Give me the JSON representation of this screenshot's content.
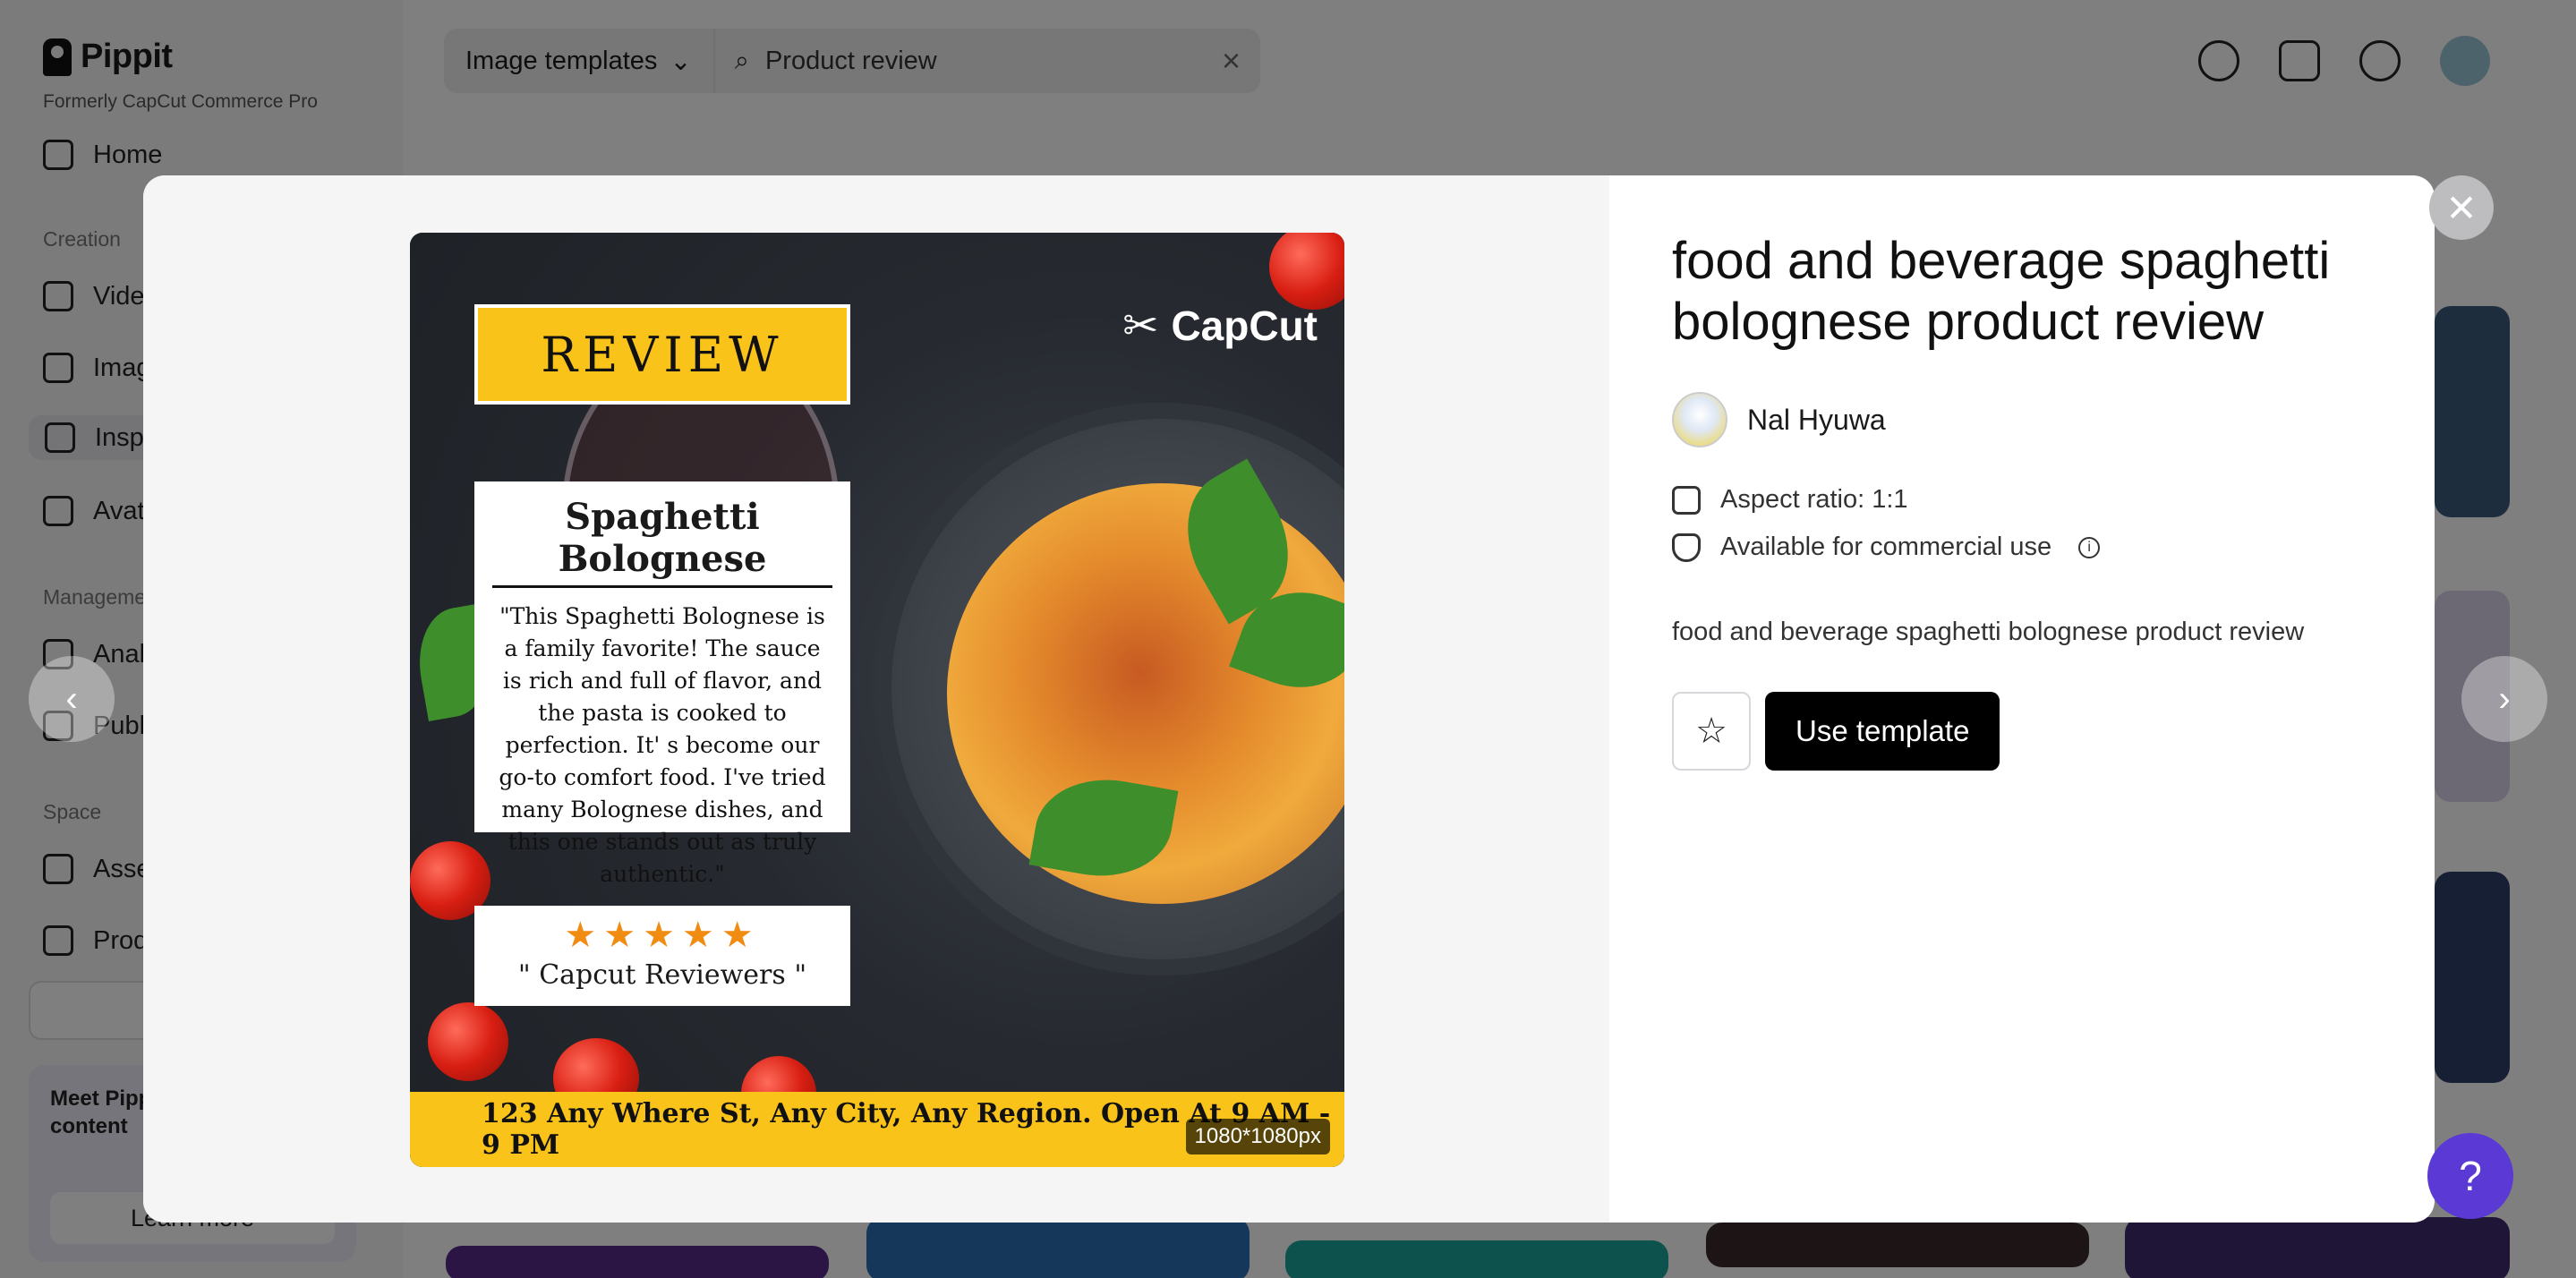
{
  "app": {
    "brand": "Pippit",
    "brand_sub": "Formerly CapCut Commerce Pro",
    "sidebar": {
      "home": "Home",
      "sections": [
        "Creation",
        "Manageme",
        "Space"
      ],
      "items": [
        "Vide",
        "Imag",
        "Insp",
        "Avat",
        "Anal",
        "Publ",
        "Asse",
        "Prod"
      ]
    },
    "promo": {
      "text": "Meet Pipp creative a content",
      "button": "Learn more"
    },
    "search": {
      "category": "Image templates",
      "query": "Product review"
    }
  },
  "modal": {
    "title": "food and beverage spaghetti bolognese product review",
    "author": "Nal Hyuwa",
    "aspect_ratio": "Aspect ratio: 1:1",
    "commercial": "Available for commercial use",
    "description": "food and beverage spaghetti bolognese product review",
    "use_button": "Use template",
    "preview": {
      "banner": "REVIEW",
      "brand": "CapCut",
      "card_title": "Spaghetti Bolognese",
      "card_text": "\"This Spaghetti Bolognese is a family favorite! The sauce is rich and full of flavor, and the pasta is cooked to perfection. It' s become our go-to comfort food. I've tried many Bolognese dishes, and this one stands out as truly authentic.\"",
      "rating_stars": "★★★★★",
      "rating_label": "\" Capcut Reviewers \"",
      "address": "123 Any Where St, Any City, Any Region. Open At 9 AM - 9 PM",
      "dimensions": "1080*1080px"
    }
  },
  "icons": {
    "close": "✕",
    "prev": "‹",
    "next": "›",
    "star_outline": "☆",
    "help": "?"
  }
}
